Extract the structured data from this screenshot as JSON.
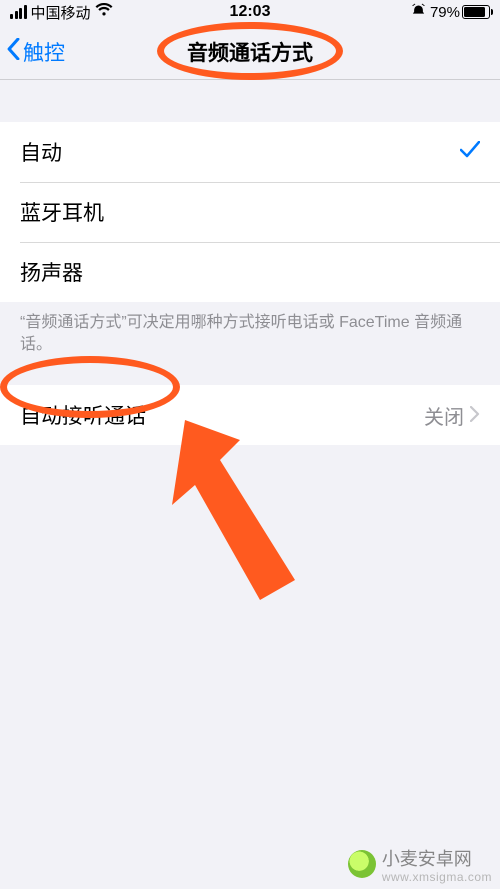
{
  "status": {
    "carrier": "中国移动",
    "time": "12:03",
    "battery_pct": "79%"
  },
  "nav": {
    "back_label": "触控",
    "title": "音频通话方式"
  },
  "options": {
    "auto": "自动",
    "bluetooth": "蓝牙耳机",
    "speaker": "扬声器",
    "selected": "auto"
  },
  "footer": "“音频通话方式”可决定用哪种方式接听电话或 FaceTime 音频通话。",
  "auto_answer": {
    "label": "自动接听通话",
    "value": "关闭"
  },
  "watermark": {
    "name": "小麦安卓网",
    "url": "www.xmsigma.com"
  }
}
